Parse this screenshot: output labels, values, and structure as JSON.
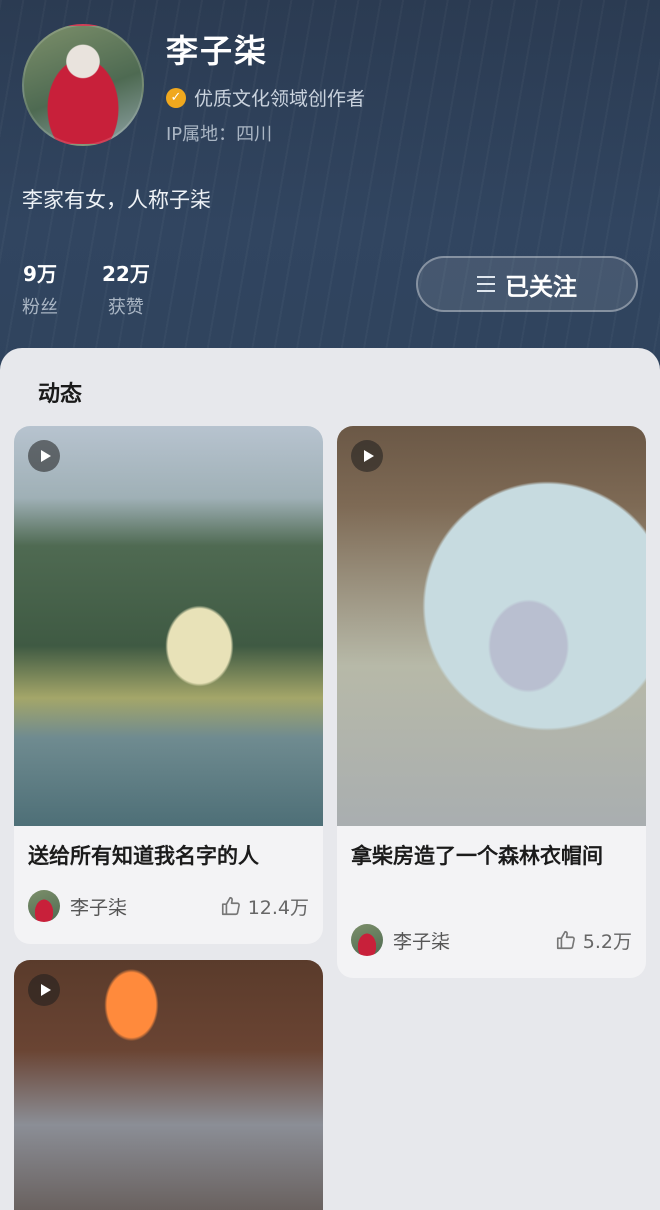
{
  "profile": {
    "name": "李子柒",
    "verified_label": "优质文化领域创作者",
    "ip": "IP属地：四川",
    "bio": "李家有女，人称子柒"
  },
  "stats": [
    {
      "value": "9万",
      "label": "粉丝"
    },
    {
      "value": "22万",
      "label": "获赞"
    }
  ],
  "follow_button": {
    "label": "已关注",
    "icon": "menu-icon"
  },
  "feed": {
    "section_title": "动态",
    "cards": [
      {
        "title": "送给所有知道我名字的人",
        "author": "李子柒",
        "likes": "12.4万",
        "type": "video"
      },
      {
        "title": "拿柴房造了一个森林衣帽间",
        "author": "李子柒",
        "likes": "5.2万",
        "type": "video"
      },
      {
        "title": "",
        "author": "",
        "likes": "",
        "type": "video"
      }
    ]
  },
  "colors": {
    "header_bg": "#2f435d",
    "feed_bg": "#e7e8ec",
    "verified_badge": "#f0a81e"
  }
}
